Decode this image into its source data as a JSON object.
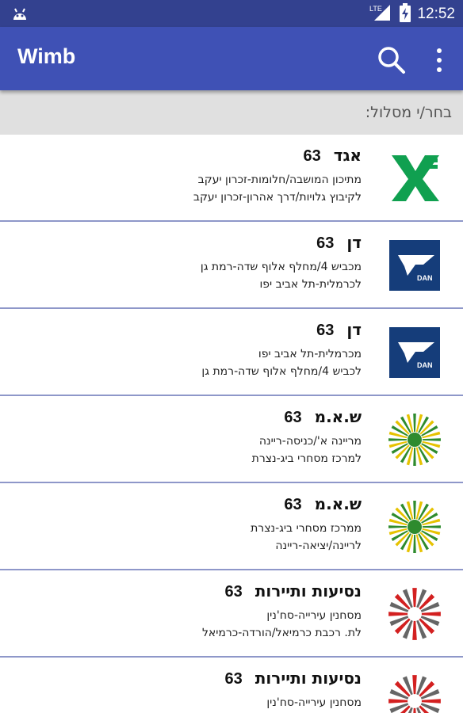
{
  "status_bar": {
    "time": "12:52",
    "network": "LTE"
  },
  "app_bar": {
    "title": "Wimb"
  },
  "list_header": "בחר/י מסלול:",
  "routes": [
    {
      "operator": "אגד",
      "number": "63",
      "origin": "מתיכון המושבה/חלומות-זכרון יעקב",
      "destination": "לקיבוץ גלויות/דרך אהרון-זכרון יעקב",
      "logo": "egged-logo"
    },
    {
      "operator": "דן",
      "number": "63",
      "origin": "מכביש 4/מחלף אלוף שדה-רמת גן",
      "destination": "לכרמלית-תל אביב יפו",
      "logo": "dan-logo"
    },
    {
      "operator": "דן",
      "number": "63",
      "origin": "מכרמלית-תל אביב יפו",
      "destination": "לכביש 4/מחלף אלוף שדה-רמת גן",
      "logo": "dan-logo"
    },
    {
      "operator": "ש.א.מ",
      "number": "63",
      "origin": "מריינה א'/כניסה-ריינה",
      "destination": "למרכז מסחרי ביג-נצרת",
      "logo": "sam-logo"
    },
    {
      "operator": "ש.א.מ",
      "number": "63",
      "origin": "ממרכז מסחרי ביג-נצרת",
      "destination": "לריינה/יציאה-ריינה",
      "logo": "sam-logo"
    },
    {
      "operator": "נסיעות ותיירות",
      "number": "63",
      "origin": "מסחנין עירייה-סח'נין",
      "destination": "לת. רכבת כרמיאל/הורדה-כרמיאל",
      "logo": "nateev-logo"
    },
    {
      "operator": "נסיעות ותיירות",
      "number": "63",
      "origin": "מסחנין עירייה-סח'נין",
      "destination": "",
      "logo": "nateev-logo"
    }
  ],
  "colors": {
    "primary": "#3f51b5",
    "primary_dark": "#33418f",
    "divider": "#8e97c9",
    "header_bg": "#e0e0e0"
  }
}
